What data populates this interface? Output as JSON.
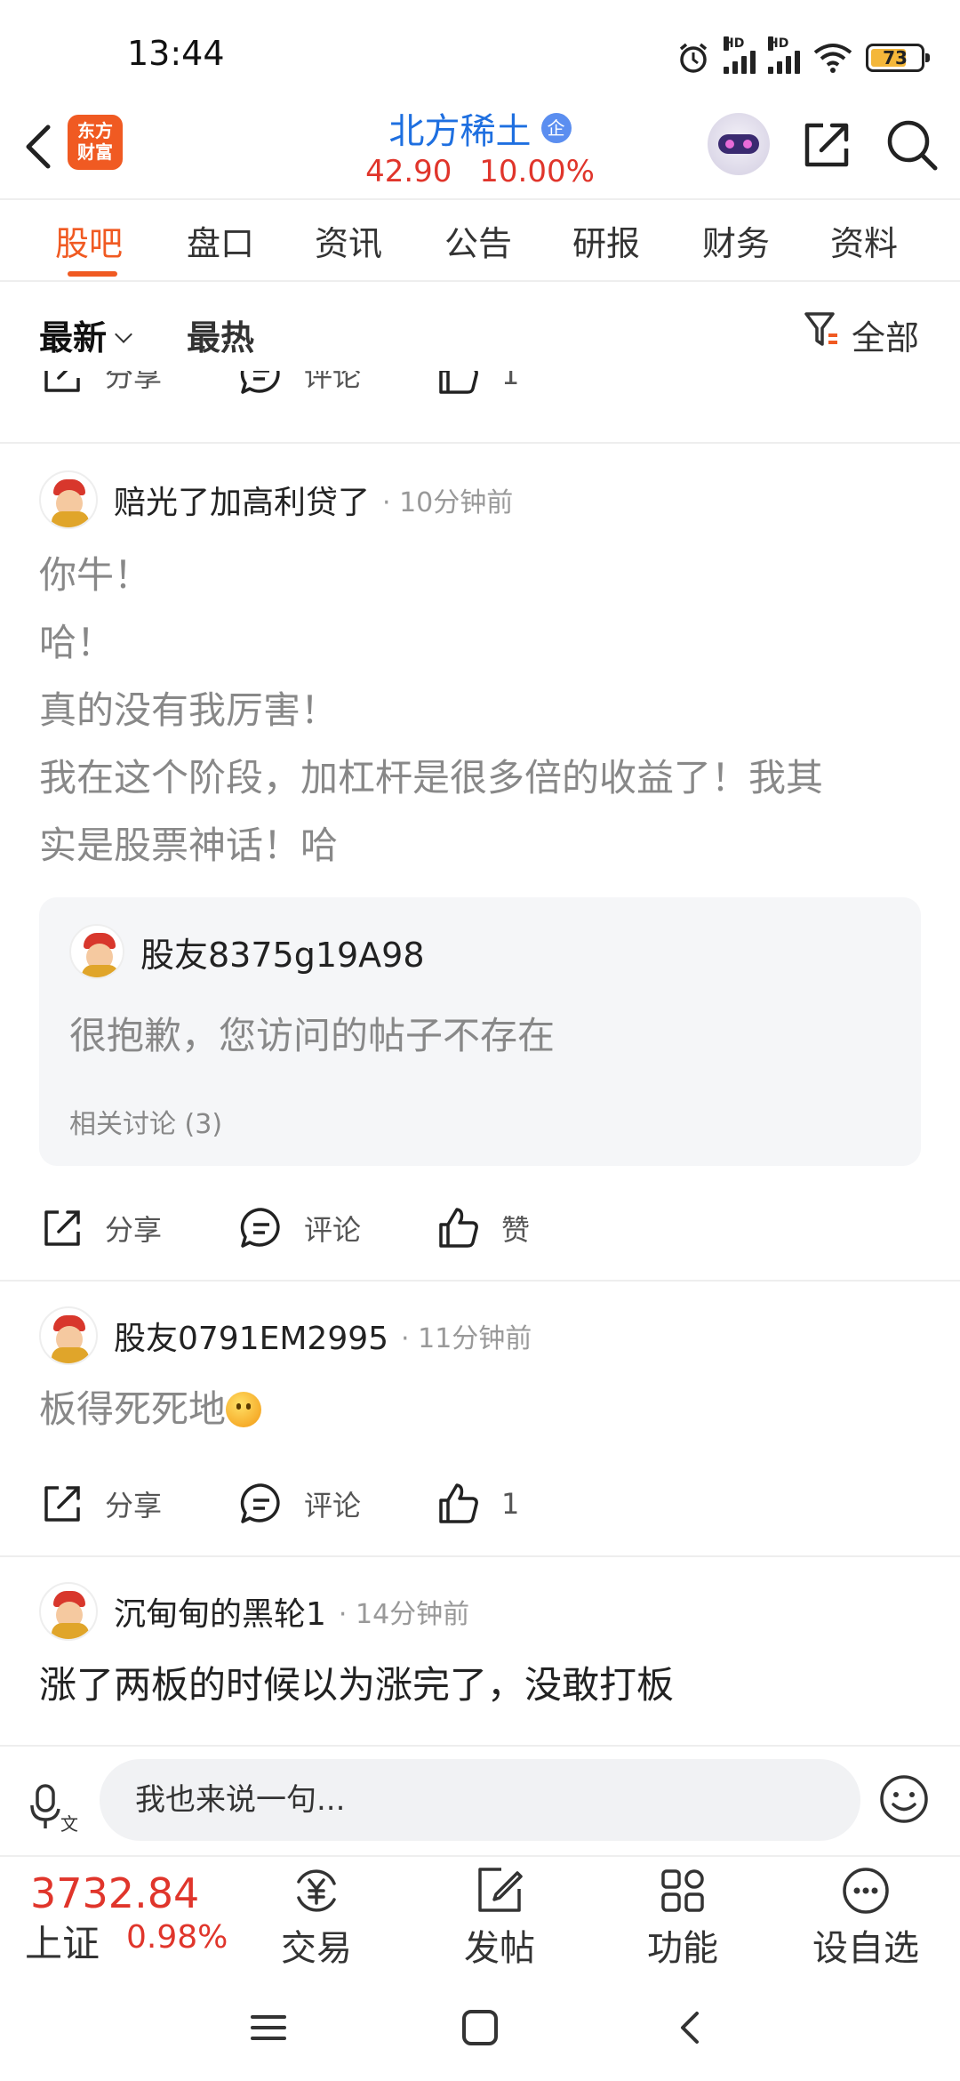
{
  "status_bar": {
    "time": "13:44",
    "battery": "73",
    "hd_label": "HD"
  },
  "header": {
    "logo_text": [
      "东方",
      "财富"
    ],
    "stock_name": "北方稀土",
    "verified_badge": "企",
    "price": "42.90",
    "change_pct": "10.00%"
  },
  "tabs": [
    {
      "label": "股吧",
      "active": true
    },
    {
      "label": "盘口"
    },
    {
      "label": "资讯"
    },
    {
      "label": "公告"
    },
    {
      "label": "研报"
    },
    {
      "label": "财务"
    },
    {
      "label": "资料"
    }
  ],
  "filter": {
    "latest": "最新",
    "hot": "最热",
    "scope": "全部"
  },
  "partial_post_actions": {
    "share": "分享",
    "comment": "评论",
    "like": "1"
  },
  "posts": [
    {
      "author": "赔光了加高利贷了",
      "time": "10分钟前",
      "lines": [
        "你牛！",
        "哈！",
        "真的没有我厉害！",
        "我在这个阶段，加杠杆是很多倍的收益了！我其",
        "实是股票神话！哈"
      ],
      "quote": {
        "author": "股友8375g19A98",
        "text": "很抱歉，您访问的帖子不存在",
        "related": "相关讨论 (3)"
      },
      "actions": {
        "share": "分享",
        "comment": "评论",
        "like": "赞"
      }
    },
    {
      "author": "股友0791EM2995",
      "time": "11分钟前",
      "text": "板得死死地",
      "emoji": "smile-emoji",
      "actions": {
        "share": "分享",
        "comment": "评论",
        "like": "1"
      }
    },
    {
      "author": "沉甸甸的黑轮1",
      "time": "14分钟前",
      "text": "涨了两板的时候以为涨完了，没敢打板"
    }
  ],
  "comment_bar": {
    "placeholder": "我也来说一句..."
  },
  "toolbar": {
    "index_value": "3732.84",
    "index_name": "上证",
    "index_change": "0.98%",
    "items": [
      {
        "label": "交易",
        "icon": "yuan-cycle-icon"
      },
      {
        "label": "发帖",
        "icon": "edit-icon"
      },
      {
        "label": "功能",
        "icon": "apps-icon"
      },
      {
        "label": "设自选",
        "icon": "more-icon"
      }
    ]
  },
  "colors": {
    "accent": "#f05a22",
    "up": "#e0352b",
    "link": "#1e6fe0"
  }
}
